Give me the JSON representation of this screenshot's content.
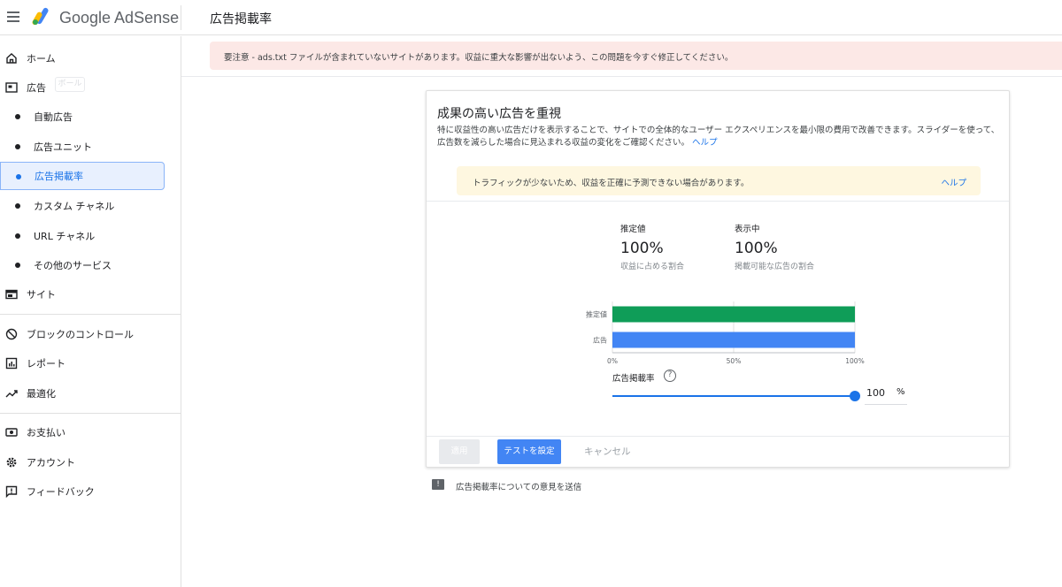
{
  "app": {
    "brand": "Google AdSense",
    "page_title": "広告掲載率"
  },
  "sidebar": {
    "items": [
      {
        "label": "ホーム",
        "icon": "home-icon"
      },
      {
        "label": "広告",
        "icon": "ads-icon"
      },
      {
        "label": "自動広告"
      },
      {
        "label": "広告ユニット"
      },
      {
        "label": "広告掲載率"
      },
      {
        "label": "カスタム チャネル"
      },
      {
        "label": "URL チャネル"
      },
      {
        "label": "その他のサービス"
      },
      {
        "label": "サイト",
        "icon": "sites-icon"
      },
      {
        "label": "ブロックのコントロール",
        "icon": "block-icon"
      },
      {
        "label": "レポート",
        "icon": "reports-icon"
      },
      {
        "label": "最適化",
        "icon": "trending-up-icon"
      },
      {
        "label": "お支払い",
        "icon": "payments-icon"
      },
      {
        "label": "アカウント",
        "icon": "gear-icon"
      },
      {
        "label": "フィードバック",
        "icon": "feedback-icon"
      }
    ],
    "ghost_label": "ボール"
  },
  "banner": {
    "text": "要注意 - ads.txt ファイルが含まれていないサイトがあります。収益に重大な影響が出ないよう、この問題を今すぐ修正してください。"
  },
  "card": {
    "title": "成果の高い広告を重視",
    "description": "特に収益性の高い広告だけを表示することで、サイトでの全体的なユーザー エクスペリエンスを最小限の費用で改善できます。スライダーを使って、広告数を減らした場合に見込まれる収益の変化をご確認ください。",
    "description_link": "ヘルプ",
    "notice": {
      "text": "トラフィックが少ないため、収益を正確に予測できない場合があります。",
      "link": "ヘルプ"
    },
    "stats": [
      {
        "heading": "推定値",
        "value": "100%",
        "sub": "収益に占める割合"
      },
      {
        "heading": "表示中",
        "value": "100%",
        "sub": "掲載可能な広告の割合"
      }
    ],
    "rate": {
      "label": "広告掲載率",
      "help": "?",
      "value": "100",
      "unit": "%"
    },
    "buttons": {
      "apply": "適用",
      "test": "テストを設定",
      "cancel": "キャンセル"
    }
  },
  "chart_data": {
    "type": "bar",
    "orientation": "horizontal",
    "categories": [
      "推定値",
      "広告"
    ],
    "values": [
      100,
      100
    ],
    "colors": [
      "#0f9d58",
      "#4285f4"
    ],
    "xlim": [
      0,
      100
    ],
    "tick_labels": [
      "0%",
      "50%",
      "100%"
    ],
    "grid": true
  },
  "feedback": {
    "text": "広告掲載率についての意見を送信",
    "icon": "feedback-icon"
  },
  "colors": {
    "accent": "#1a73e8",
    "warning_bg": "#fce8e6",
    "notice_bg": "#fef7e0"
  }
}
